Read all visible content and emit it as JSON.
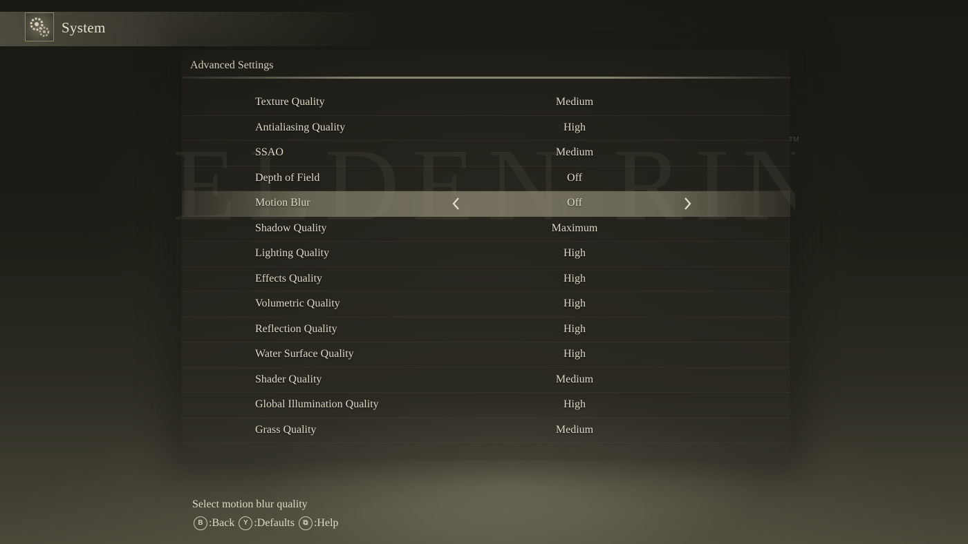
{
  "header": {
    "title": "System",
    "icon": "gear-icon"
  },
  "watermark": {
    "text": "ELDEN RING",
    "tm": "TM"
  },
  "section": {
    "title": "Advanced Settings"
  },
  "settings": [
    {
      "label": "Texture Quality",
      "value": "Medium"
    },
    {
      "label": "Antialiasing Quality",
      "value": "High"
    },
    {
      "label": "SSAO",
      "value": "Medium"
    },
    {
      "label": "Depth of Field",
      "value": "Off"
    },
    {
      "label": "Motion Blur",
      "value": "Off",
      "selected": true
    },
    {
      "label": "Shadow Quality",
      "value": "Maximum"
    },
    {
      "label": "Lighting Quality",
      "value": "High"
    },
    {
      "label": "Effects Quality",
      "value": "High"
    },
    {
      "label": "Volumetric Quality",
      "value": "High"
    },
    {
      "label": "Reflection Quality",
      "value": "High"
    },
    {
      "label": "Water Surface Quality",
      "value": "High"
    },
    {
      "label": "Shader Quality",
      "value": "Medium"
    },
    {
      "label": "Global Illumination Quality",
      "value": "High"
    },
    {
      "label": "Grass Quality",
      "value": "Medium"
    }
  ],
  "footer": {
    "hint": "Select motion blur quality",
    "controls": [
      {
        "glyph": "B",
        "label": ":Back"
      },
      {
        "glyph": "Y",
        "label": ":Defaults"
      },
      {
        "glyph": "⧉",
        "label": ":Help"
      }
    ]
  }
}
